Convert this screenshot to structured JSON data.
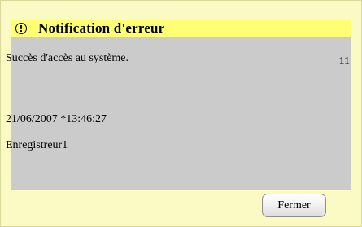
{
  "dialog": {
    "title": "Notification d'erreur",
    "title_icon": "exclamation-circle-icon",
    "message": "Succès d'accès au système.",
    "code": "11",
    "datetime": "21/06/2007 *13:46:27",
    "source": "Enregistreur1",
    "close_label": "Fermer"
  },
  "colors": {
    "dialog_background": "#fbfac4",
    "title_bar": "#ffff73",
    "content_background": "#cbcbcb"
  }
}
